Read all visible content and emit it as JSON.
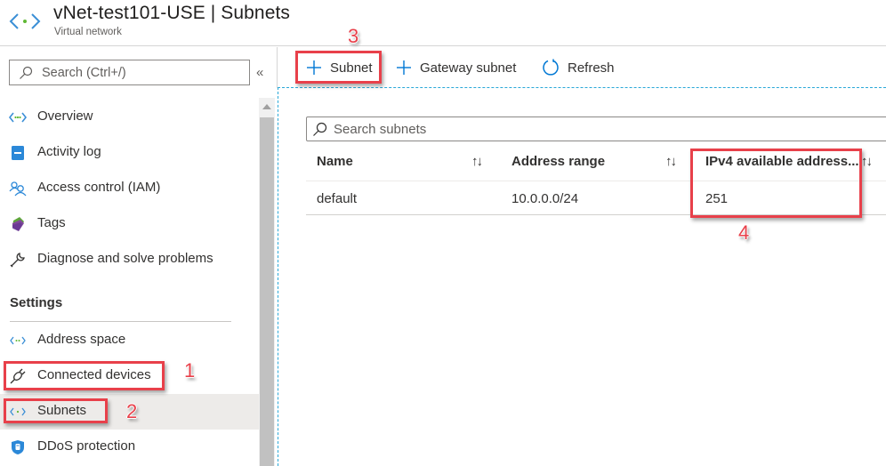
{
  "header": {
    "title": "vNet-test101-USE | Subnets",
    "subtitle": "Virtual network",
    "icon": "virtual-network-icon"
  },
  "sidebar": {
    "search_placeholder": "Search (Ctrl+/)",
    "collapse_glyph": "«",
    "items": [
      {
        "label": "Overview",
        "icon": "virtual-network-icon"
      },
      {
        "label": "Activity log",
        "icon": "activity-log-icon"
      },
      {
        "label": "Access control (IAM)",
        "icon": "people-icon"
      },
      {
        "label": "Tags",
        "icon": "tag-icon"
      },
      {
        "label": "Diagnose and solve problems",
        "icon": "wrench-icon"
      }
    ],
    "section_label": "Settings",
    "settings_items": [
      {
        "label": "Address space",
        "icon": "virtual-network-icon"
      },
      {
        "label": "Connected devices",
        "icon": "plug-icon"
      },
      {
        "label": "Subnets",
        "icon": "virtual-network-icon",
        "selected": true
      },
      {
        "label": "DDoS protection",
        "icon": "shield-icon"
      }
    ]
  },
  "toolbar": {
    "add_subnet": "Subnet",
    "add_gateway_subnet": "Gateway subnet",
    "refresh": "Refresh"
  },
  "main": {
    "search_placeholder": "Search subnets",
    "columns": [
      {
        "label": "Name",
        "sort_glyph": "↑↓"
      },
      {
        "label": "Address range",
        "sort_glyph": "↑↓"
      },
      {
        "label": "IPv4 available address...",
        "sort_glyph": "↑↓"
      }
    ],
    "rows": [
      {
        "name": "default",
        "address_range": "10.0.0.0/24",
        "ipv4_available": "251"
      }
    ]
  },
  "annotations": [
    "1",
    "2",
    "3",
    "4"
  ],
  "colors": {
    "accent": "#0078d4",
    "annotation": "#e8404a",
    "selected_bg": "#edebe9"
  }
}
